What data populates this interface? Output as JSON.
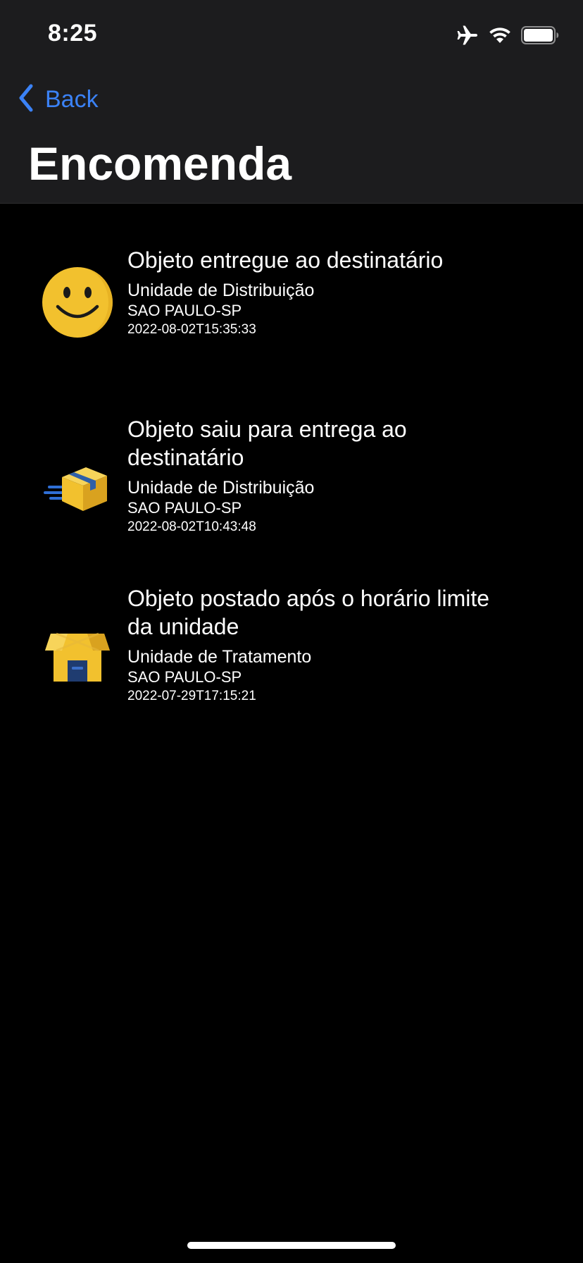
{
  "status_bar": {
    "time": "8:25",
    "icons": [
      "airplane-icon",
      "wifi-icon",
      "battery-icon"
    ]
  },
  "nav": {
    "back_label": "Back",
    "title": "Encomenda"
  },
  "colors": {
    "accent": "#3b82f6",
    "header_bg": "#1c1c1e",
    "background": "#000000"
  },
  "events": [
    {
      "icon": "smiley-face-icon",
      "title": "Objeto entregue ao destinatário",
      "unit": "Unidade de Distribuição",
      "city": "SAO PAULO-SP",
      "datetime": "2022-08-02T15:35:33"
    },
    {
      "icon": "delivery-package-icon",
      "title": "Objeto saiu para entrega ao destinatário",
      "unit": "Unidade de Distribuição",
      "city": "SAO PAULO-SP",
      "datetime": "2022-08-02T10:43:48"
    },
    {
      "icon": "post-office-icon",
      "title": "Objeto postado após o horário limite da unidade",
      "unit": "Unidade de Tratamento",
      "city": "SAO PAULO-SP",
      "datetime": "2022-07-29T17:15:21"
    }
  ]
}
